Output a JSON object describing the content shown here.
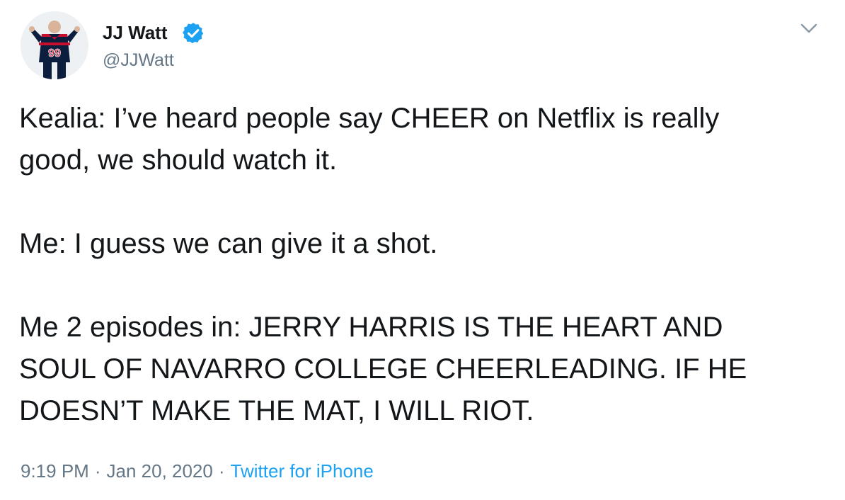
{
  "author": {
    "display_name": "JJ Watt",
    "handle": "@JJWatt",
    "verified": true,
    "jersey_number": "99"
  },
  "tweet": {
    "paragraphs": [
      "Kealia: I’ve heard people say CHEER on Netflix is really\ngood, we should watch it.",
      "Me: I guess we can give it a shot.",
      "Me 2 episodes in: JERRY HARRIS IS THE HEART AND\nSOUL OF NAVARRO COLLEGE CHEERLEADING. IF HE\nDOESN’T MAKE THE MAT, I WILL RIOT."
    ],
    "time": "9:19 PM",
    "date": "Jan 20, 2020",
    "source": "Twitter for iPhone",
    "separator": "·"
  },
  "icons": {
    "verified": "verified-badge-icon",
    "menu": "chevron-down-icon"
  },
  "colors": {
    "text": "#14171a",
    "secondary": "#657786",
    "accent": "#1da1f2",
    "background": "#ffffff"
  }
}
